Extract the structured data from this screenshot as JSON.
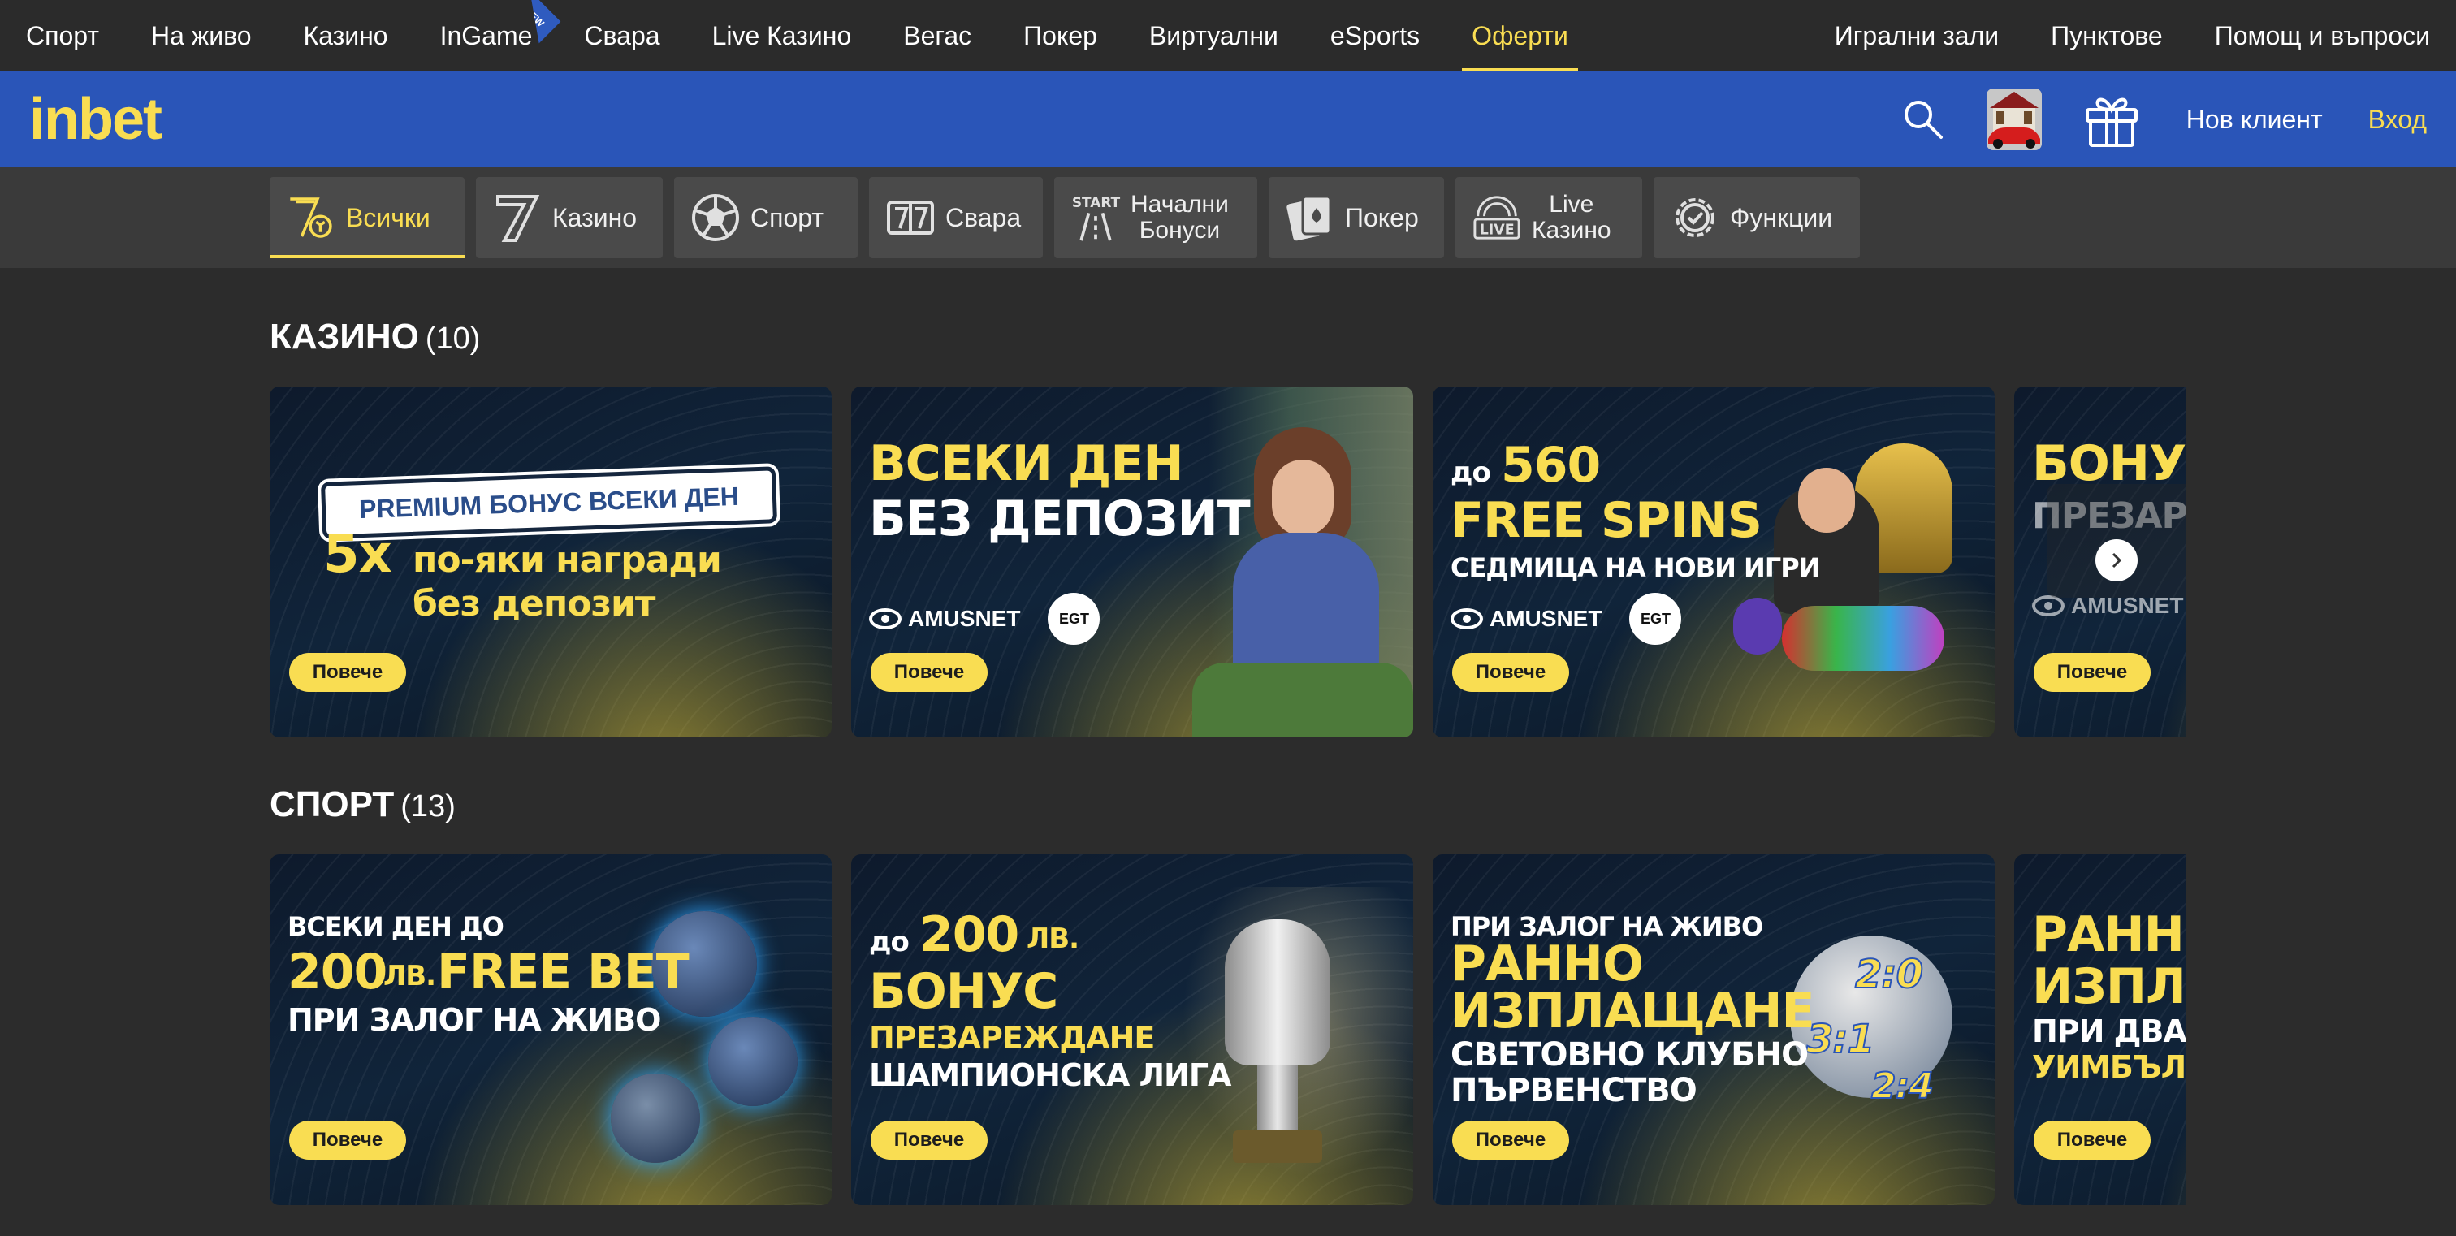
{
  "topnav": {
    "left": [
      {
        "label": "Спорт"
      },
      {
        "label": "На живо"
      },
      {
        "label": "Казино"
      },
      {
        "label": "InGame",
        "badge": "NEW"
      },
      {
        "label": "Свара"
      },
      {
        "label": "Live Казино"
      },
      {
        "label": "Вегас"
      },
      {
        "label": "Покер"
      },
      {
        "label": "Виртуални"
      },
      {
        "label": "eSports"
      },
      {
        "label": "Оферти",
        "active": true
      }
    ],
    "right": [
      {
        "label": "Игрални зали"
      },
      {
        "label": "Пунктове"
      },
      {
        "label": "Помощ и въпроси"
      }
    ]
  },
  "header": {
    "logo": "inbet",
    "icons": [
      "search-icon",
      "car-promo-icon",
      "gift-icon"
    ],
    "new_client": "Нов клиент",
    "login": "Вход"
  },
  "categories": [
    {
      "label": "Всички",
      "icon": "slot-seven-ball-icon",
      "active": true
    },
    {
      "label": "Казино",
      "icon": "seven-icon"
    },
    {
      "label": "Спорт",
      "icon": "soccer-ball-icon"
    },
    {
      "label": "Свара",
      "icon": "card-seven-icon"
    },
    {
      "label_1": "Начални",
      "label_2": "Бонуси",
      "icon": "start-road-icon"
    },
    {
      "label": "Покер",
      "icon": "poker-cards-icon"
    },
    {
      "label_1": "Live",
      "label_2": "Казино",
      "icon": "live-icon"
    },
    {
      "label": "Функции",
      "icon": "settings-check-icon"
    }
  ],
  "sections": {
    "casino": {
      "title": "КАЗИНО",
      "count": "(10)",
      "cards": [
        {
          "plate": "PREMIUM БОНУС ВСЕКИ ДЕН",
          "line1_big": "5x",
          "line1": "по-яки награди",
          "line2": "без депозит",
          "button": "Повече"
        },
        {
          "line1": "ВСЕКИ ДЕН",
          "line2": "БЕЗ ДЕПОЗИТ",
          "brand": "AMUSNET",
          "egt": "EGT",
          "button": "Повече"
        },
        {
          "pre": "до",
          "big": "560",
          "line1": "FREE SPINS",
          "line2": "СЕДМИЦА НА НОВИ ИГРИ",
          "brand": "AMUSNET",
          "egt": "EGT",
          "button": "Повече"
        },
        {
          "line1": "БОНУС",
          "line2": "ПРЕЗАР",
          "brand": "AMUSNET",
          "button": "Повече"
        }
      ]
    },
    "sport": {
      "title": "СПОРТ",
      "count": "(13)",
      "cards": [
        {
          "line1": "ВСЕКИ ДЕН ДО",
          "big": "200",
          "unit": "ЛВ.",
          "line2": "FREE BET",
          "line3": "ПРИ ЗАЛОГ НА ЖИВО",
          "button": "Повече"
        },
        {
          "pre": "до",
          "big": "200",
          "unit": "ЛВ.",
          "line1": "БОНУС",
          "line2": "ПРЕЗАРЕЖДАНЕ",
          "line3": "ШАМПИОНСКА ЛИГА",
          "button": "Повече"
        },
        {
          "line1": "ПРИ ЗАЛОГ НА ЖИВО",
          "line2": "РАННО",
          "line3": "ИЗПЛАЩАНЕ",
          "line4": "СВЕТОВНО КЛУБНО",
          "line5": "ПЪРВЕНСТВО",
          "scores": [
            "2:0",
            "3:1",
            "2:4"
          ],
          "button": "Повече"
        },
        {
          "line1": "РАННО",
          "line2": "ИЗПЛА",
          "line3": "ПРИ ДВА",
          "line4": "УИМБЪЛД",
          "button": "Повече"
        }
      ]
    }
  },
  "colors": {
    "accent": "#f9dd52",
    "header_blue": "#2a55b8",
    "topnav_bg": "#2b2b2b",
    "page_bg": "#2c2c2c"
  }
}
